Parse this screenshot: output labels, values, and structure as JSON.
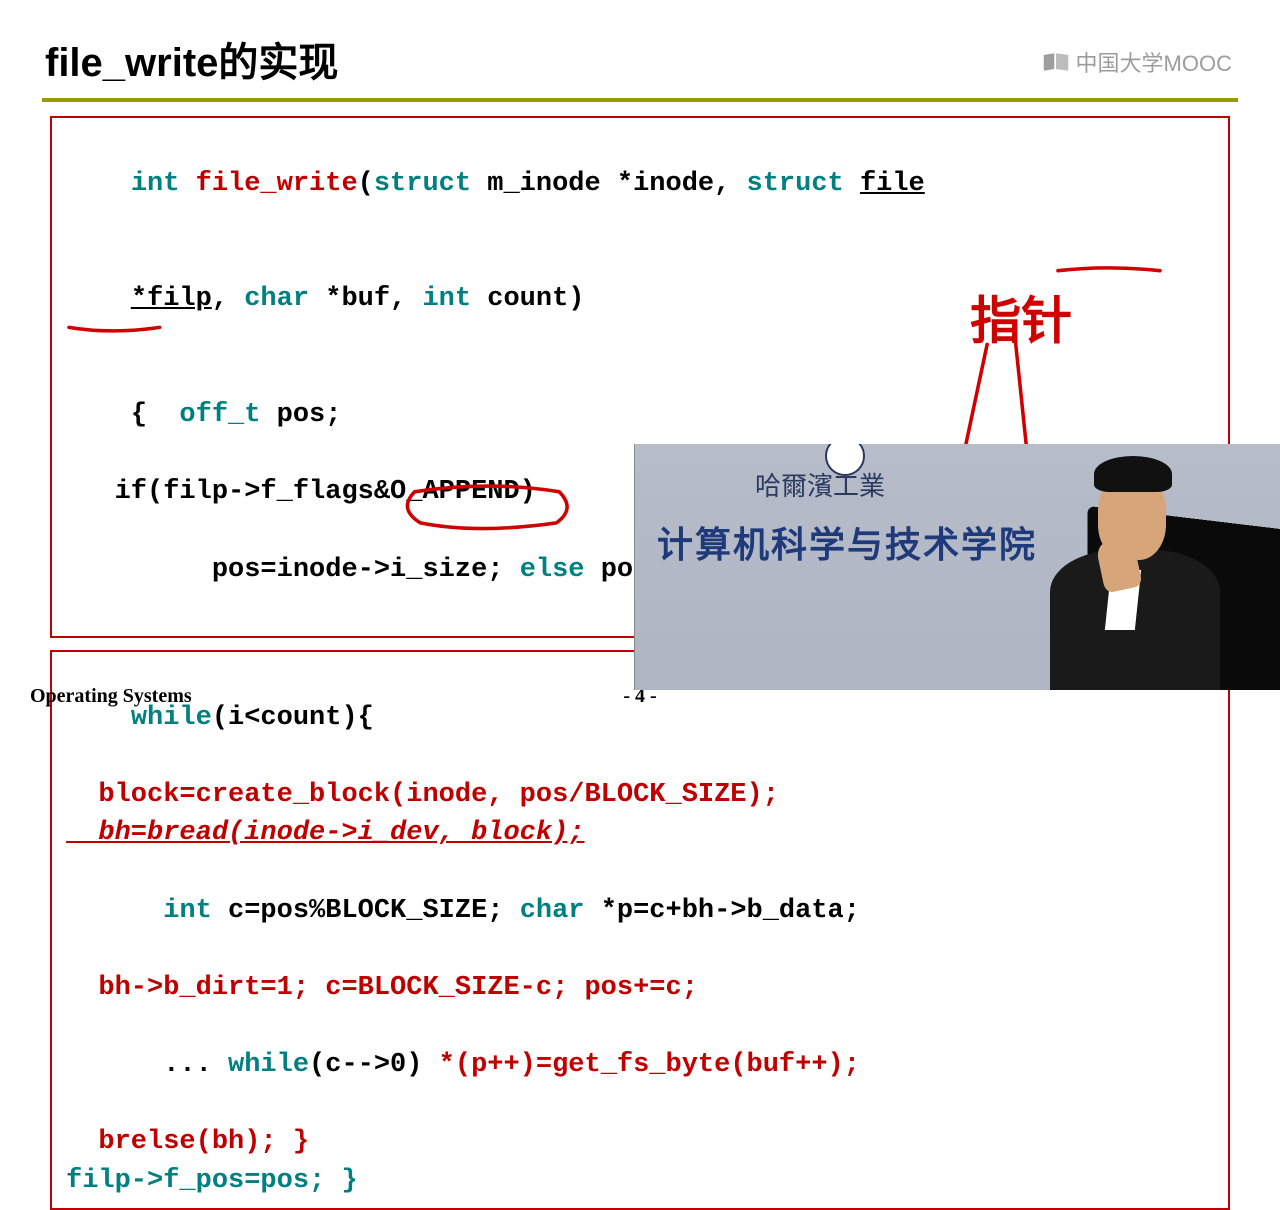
{
  "header": {
    "title": "file_write的实现",
    "mooc_text": "中国大学MOOC"
  },
  "codebox1": {
    "l1_type": "int ",
    "l1_fn": "file_write",
    "l1_rest1": "(",
    "l1_kw1": "struct",
    "l1_rest2": " m_inode *inode, ",
    "l1_kw2": "struct",
    "l1_rest3": " ",
    "l1_file": "file",
    "l2_filp": "*filp",
    "l2_rest1": ", ",
    "l2_char": "char",
    "l2_rest2": " *buf, ",
    "l2_int": "int",
    "l2_rest3": " count)",
    "l3_open": "{  ",
    "l3_off": "off_t",
    "l3_rest": " pos;",
    "l4": "   if(filp->f_flags&O_APPEND)",
    "l5a": "     pos=inode->i_size; ",
    "l5b": "else",
    "l5c": " pos=filp->f_pos;",
    "annotation_text": "指针"
  },
  "codebox2": {
    "l1_a": "while",
    "l1_b": "(i<count){",
    "l2_a": "  block=create_block(inode, pos/BLOCK_SIZE);",
    "l3_a": "  bh=bread(inode->i_dev, block);",
    "l4_a": "  ",
    "l4_b": "int",
    "l4_c": " c=pos%BLOCK_SIZE; ",
    "l4_d": "char",
    "l4_e": " *p=c+bh->b_data;",
    "l5_a": "  bh->b_dirt=1; c=BLOCK_SIZE-c; pos+=c;",
    "l6_a": "  ... ",
    "l6_b": "while",
    "l6_c": "(c-->0) ",
    "l6_d": "*(p++)=get_fs_byte(buf++);",
    "l7_a": "  brelse(bh); }",
    "l8_a": "filp->f_pos=pos; }"
  },
  "footer": {
    "left": "Operating Systems",
    "center": "- 4 -"
  },
  "pip": {
    "institution": "哈爾濱工業",
    "department": "计算机科学与技术学院"
  }
}
